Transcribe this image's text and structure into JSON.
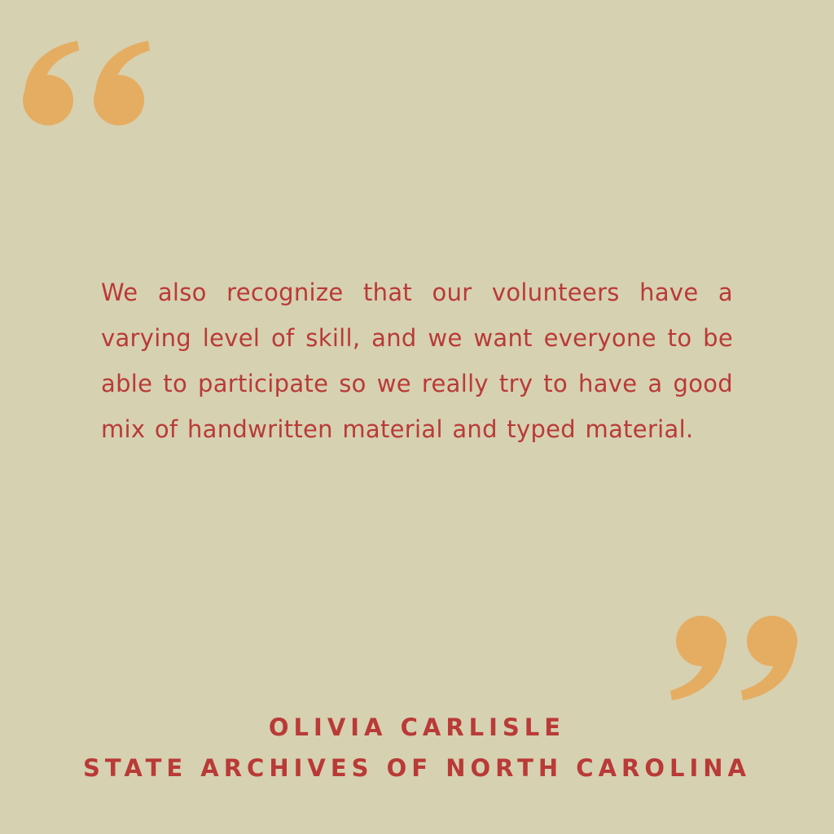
{
  "colors": {
    "background": "#d6d1b1",
    "accent_text": "#b93a37",
    "quote_marks": "#e5ad62"
  },
  "icons": {
    "open_quote": "open-quote-icon",
    "close_quote": "close-quote-icon"
  },
  "quote": {
    "text": "We also recognize that our volunteers have a varying level of skill, and we want everyone to be able to participate so we really try to have a good mix of handwritten material and typed material."
  },
  "attribution": {
    "name": "OLIVIA CARLISLE",
    "organization": "STATE ARCHIVES OF NORTH CAROLINA"
  }
}
